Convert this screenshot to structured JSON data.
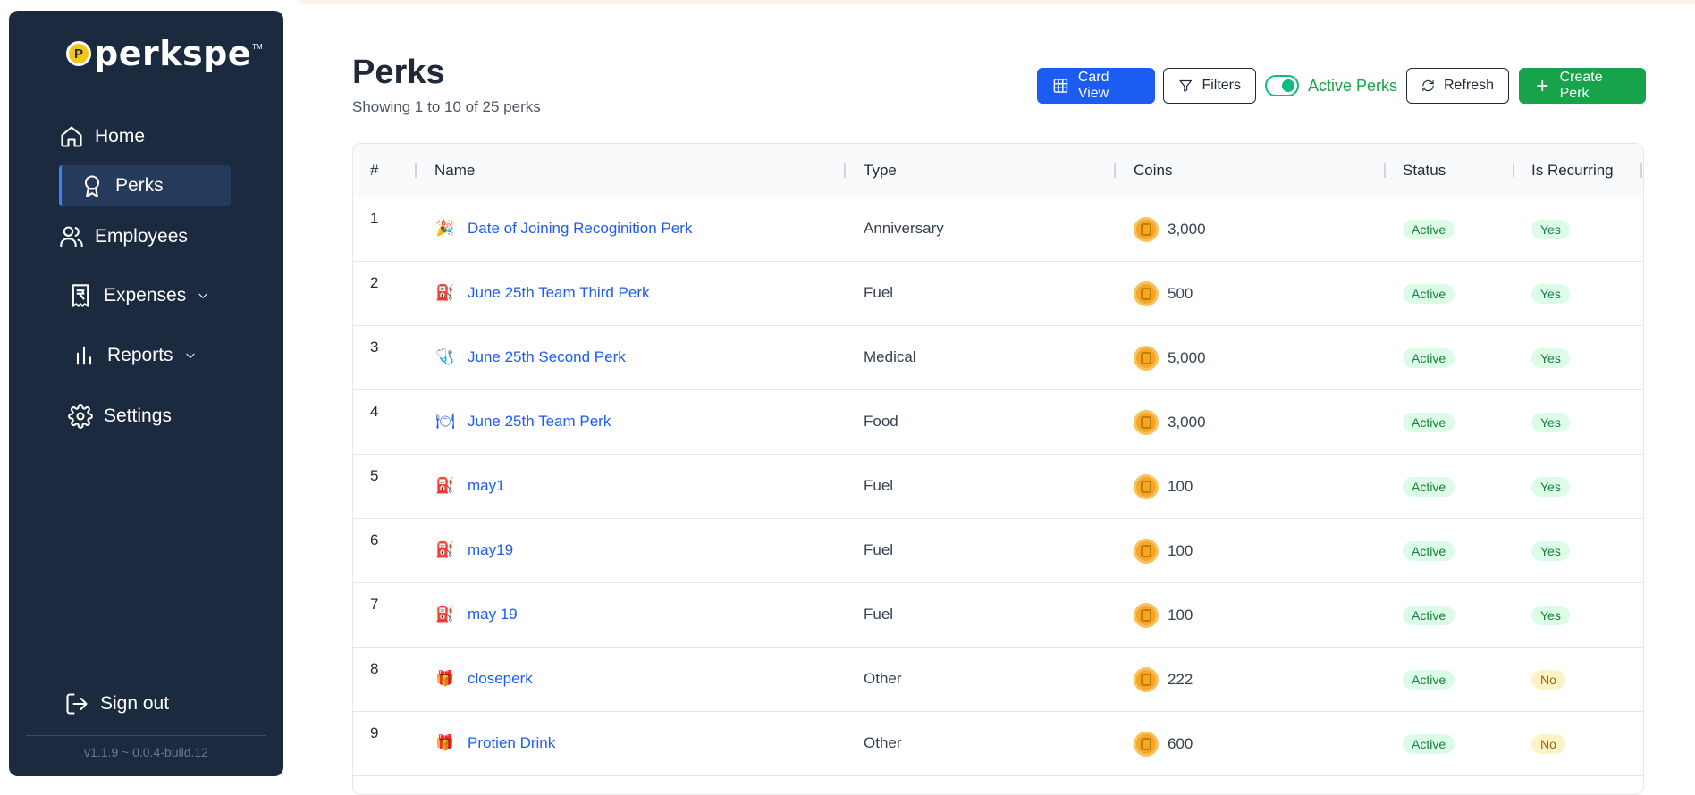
{
  "sidebar": {
    "logo_text": "perkspe",
    "logo_badge": "P",
    "logo_tm": "TM",
    "nav": [
      {
        "label": "Home",
        "icon": "home-icon"
      },
      {
        "label": "Perks",
        "icon": "award-icon",
        "active": true
      },
      {
        "label": "Employees",
        "icon": "users-icon"
      },
      {
        "label": "Expenses",
        "icon": "receipt-rupee-icon",
        "has_submenu": true
      },
      {
        "label": "Reports",
        "icon": "bar-chart-icon",
        "has_submenu": true
      },
      {
        "label": "Settings",
        "icon": "gear-icon"
      }
    ],
    "signout_label": "Sign out",
    "version": "v1.1.9 ~ 0.0.4-build.12"
  },
  "header": {
    "title": "Perks",
    "subtitle": "Showing 1 to 10 of 25 perks"
  },
  "toolbar": {
    "card_view_label": "Card View",
    "filters_label": "Filters",
    "active_perks_label": "Active Perks",
    "active_perks_on": true,
    "refresh_label": "Refresh",
    "create_label": "Create Perk"
  },
  "table": {
    "columns": [
      "#",
      "Name",
      "Type",
      "Coins",
      "Status",
      "Is Recurring"
    ],
    "rows": [
      {
        "num": "1",
        "icon": "party-popper-icon",
        "glyph": "🎉",
        "name": "Date of Joining Recoginition Perk",
        "type": "Anniversary",
        "coins": "3,000",
        "status": "Active",
        "recurring": "Yes"
      },
      {
        "num": "2",
        "icon": "fuel-pump-icon",
        "glyph": "⛽",
        "name": "June 25th Team Third Perk",
        "type": "Fuel",
        "coins": "500",
        "status": "Active",
        "recurring": "Yes"
      },
      {
        "num": "3",
        "icon": "medical-kit-icon",
        "glyph": "🩺",
        "name": "June 25th Second Perk",
        "type": "Medical",
        "coins": "5,000",
        "status": "Active",
        "recurring": "Yes"
      },
      {
        "num": "4",
        "icon": "food-plate-icon",
        "glyph": "🍽",
        "name": "June 25th Team Perk",
        "type": "Food",
        "coins": "3,000",
        "status": "Active",
        "recurring": "Yes"
      },
      {
        "num": "5",
        "icon": "fuel-pump-icon",
        "glyph": "⛽",
        "name": "may1",
        "type": "Fuel",
        "coins": "100",
        "status": "Active",
        "recurring": "Yes"
      },
      {
        "num": "6",
        "icon": "fuel-pump-icon",
        "glyph": "⛽",
        "name": "may19",
        "type": "Fuel",
        "coins": "100",
        "status": "Active",
        "recurring": "Yes"
      },
      {
        "num": "7",
        "icon": "fuel-pump-icon",
        "glyph": "⛽",
        "name": "may 19",
        "type": "Fuel",
        "coins": "100",
        "status": "Active",
        "recurring": "Yes"
      },
      {
        "num": "8",
        "icon": "gift-icon",
        "glyph": "🎁",
        "name": "closeperk",
        "type": "Other",
        "coins": "222",
        "status": "Active",
        "recurring": "No"
      },
      {
        "num": "9",
        "icon": "gift-icon",
        "glyph": "🎁",
        "name": "Protien Drink",
        "type": "Other",
        "coins": "600",
        "status": "Active",
        "recurring": "No"
      }
    ]
  },
  "colors": {
    "sidebar_bg": "#1c2a40",
    "primary_blue": "#1d5cf2",
    "success_green": "#16a34a",
    "badge_green_bg": "#dcfce7",
    "badge_yellow_bg": "#fef3c7"
  }
}
